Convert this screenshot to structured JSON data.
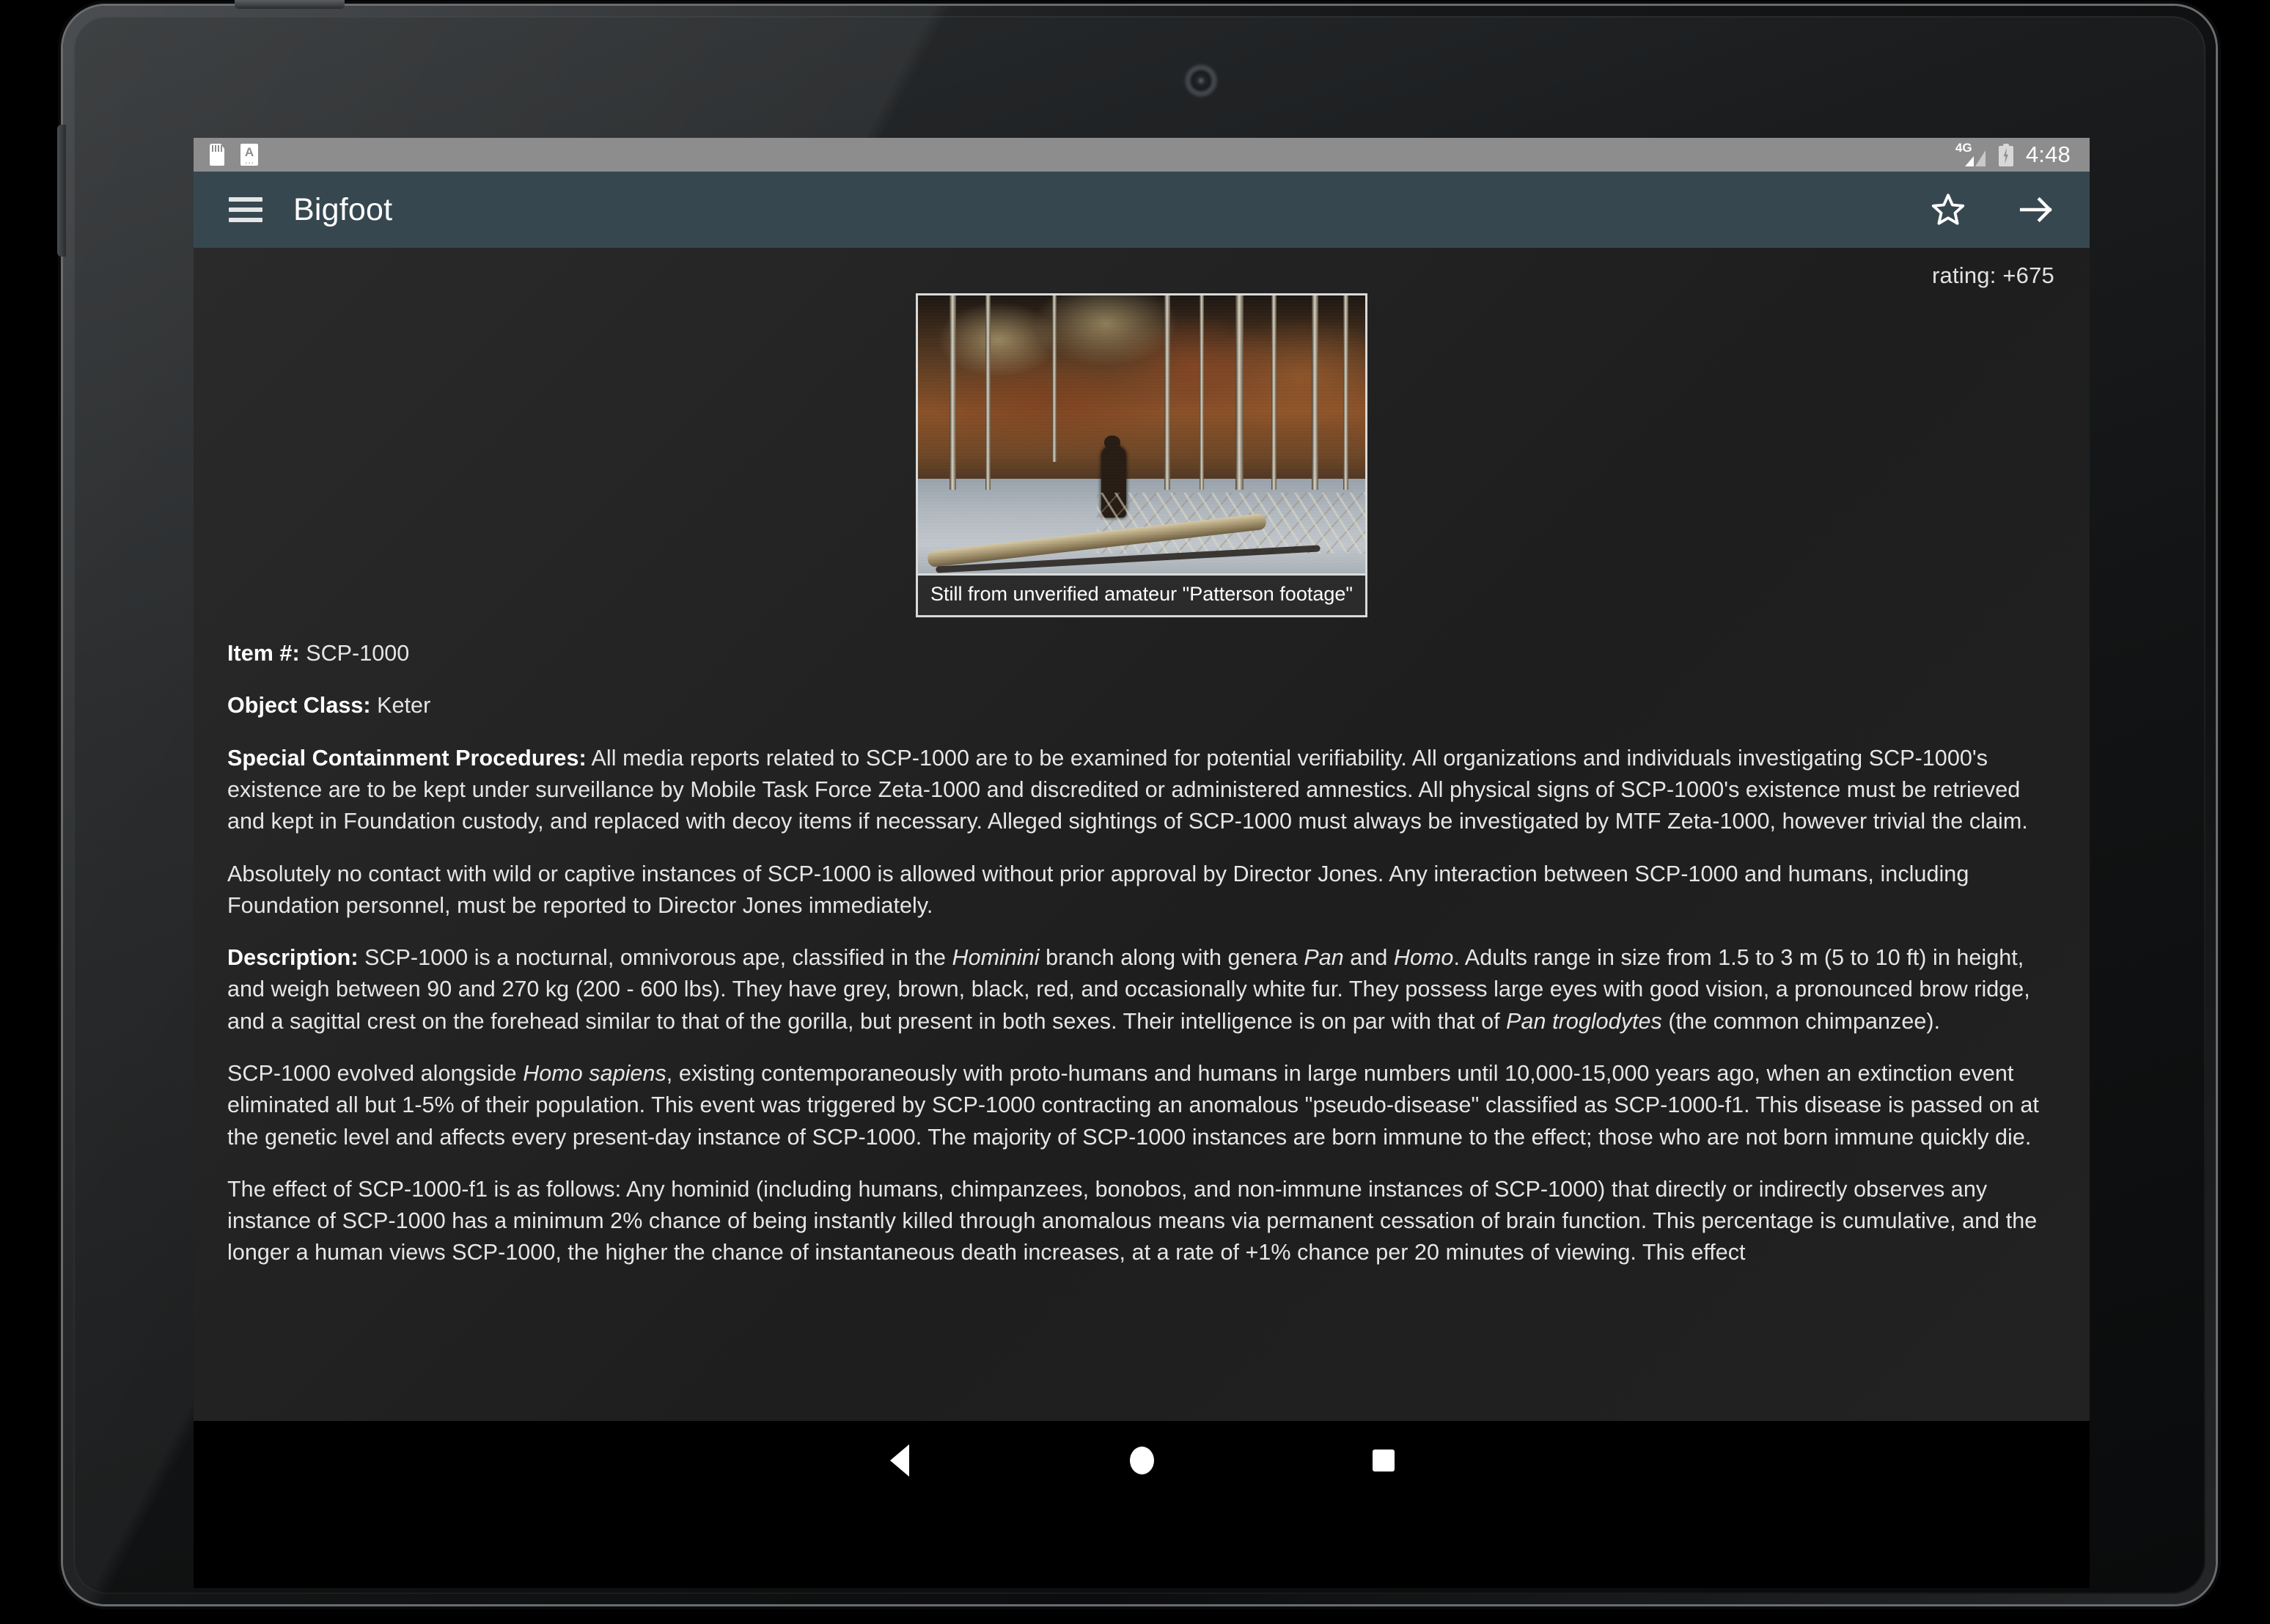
{
  "status_bar": {
    "icons": [
      "sd-card-icon",
      "document-icon"
    ],
    "network_label": "4G",
    "battery_state": "charging",
    "time": "4:48"
  },
  "app_bar": {
    "menu_icon": "hamburger-menu-icon",
    "title": "Bigfoot",
    "actions": [
      {
        "name": "favorite-star-icon",
        "label": "star"
      },
      {
        "name": "forward-arrow-icon",
        "label": "arrow"
      }
    ]
  },
  "article": {
    "rating": "rating: +675",
    "figure": {
      "caption": "Still from unverified amateur \"Patterson footage\"",
      "alt": "patterson-gimlin-film-still"
    },
    "fields": [
      {
        "label": "Item #:",
        "value": "SCP-1000"
      },
      {
        "label": "Object Class:",
        "value": "Keter"
      }
    ],
    "item_label": "Item #:",
    "item_value": "SCP-1000",
    "class_label": "Object Class:",
    "class_value": "Keter",
    "scp_label": "Special Containment Procedures:",
    "scp_text": " All media reports related to SCP-1000 are to be examined for potential verifiability. All organizations and individuals investigating SCP-1000's existence are to be kept under surveillance by Mobile Task Force Zeta-1000 and discredited or administered amnestics. All physical signs of SCP-1000's existence must be retrieved and kept in Foundation custody, and replaced with decoy items if necessary. Alleged sightings of SCP-1000 must always be investigated by MTF Zeta-1000, however trivial the claim.",
    "contact_text": "Absolutely no contact with wild or captive instances of SCP-1000 is allowed without prior approval by Director Jones. Any interaction between SCP-1000 and humans, including Foundation personnel, must be reported to Director Jones immediately.",
    "desc_label": "Description:",
    "desc_part1": " SCP-1000 is a nocturnal, omnivorous ape, classified in the ",
    "desc_it1": "Hominini",
    "desc_part2": " branch along with genera ",
    "desc_it2": "Pan",
    "desc_part3": " and ",
    "desc_it3": "Homo",
    "desc_part4": ". Adults range in size from 1.5 to 3 m (5 to 10 ft) in height, and weigh between 90 and 270 kg (200 - 600 lbs). They have grey, brown, black, red, and occasionally white fur. They possess large eyes with good vision, a pronounced brow ridge, and a sagittal crest on the forehead similar to that of the gorilla, but present in both sexes. Their intelligence is on par with that of ",
    "desc_it4": "Pan troglodytes",
    "desc_part5": " (the common chimpanzee).",
    "evo_part1": "SCP-1000 evolved alongside ",
    "evo_it1": "Homo sapiens",
    "evo_part2": ", existing contemporaneously with proto-humans and humans in large numbers until 10,000-15,000 years ago, when an extinction event eliminated all but 1-5% of their population. This event was triggered by SCP-1000 contracting an anomalous \"pseudo-disease\" classified as SCP-1000-f1. This disease is passed on at the genetic level and affects every present-day instance of SCP-1000. The majority of SCP-1000 instances are born immune to the effect; those who are not born immune quickly die.",
    "effect_text": "The effect of SCP-1000-f1 is as follows: Any hominid (including humans, chimpanzees, bonobos, and non-immune instances of SCP-1000) that directly or indirectly observes any instance of SCP-1000 has a minimum 2% chance of being instantly killed through anomalous means via permanent cessation of brain function. This percentage is cumulative, and the longer a human views SCP-1000, the higher the chance of instantaneous death increases, at a rate of +1% chance per 20 minutes of viewing. This effect"
  },
  "nav_bar": {
    "back": "back-triangle-icon",
    "home": "home-circle-icon",
    "recents": "recents-square-icon"
  },
  "colors": {
    "status_bar_bg": "#8d8d8d",
    "app_bar_bg": "#37474f",
    "content_bg": "#242424",
    "text": "#e6e6e6"
  }
}
